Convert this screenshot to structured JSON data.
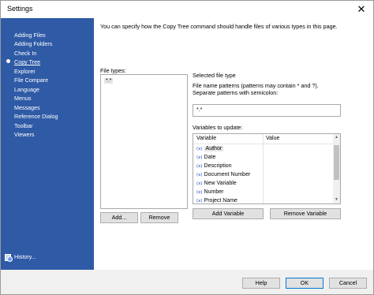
{
  "window": {
    "title": "Settings",
    "close_glyph": "✕"
  },
  "sidebar": {
    "items": [
      {
        "label": "Adding Files"
      },
      {
        "label": "Adding Folders"
      },
      {
        "label": "Check In"
      },
      {
        "label": "Copy Tree",
        "selected": true
      },
      {
        "label": "Explorer"
      },
      {
        "label": "File Compare"
      },
      {
        "label": "Language"
      },
      {
        "label": "Menus"
      },
      {
        "label": "Messages"
      },
      {
        "label": "Reference Dialog"
      },
      {
        "label": "Toolbar"
      },
      {
        "label": "Viewers"
      }
    ],
    "history_label": "History..."
  },
  "content": {
    "description": "You can specify how the Copy Tree command should handle files of various types in this page.",
    "file_types_label": "File types:",
    "file_types": [
      "*.*"
    ],
    "add_button": "Add...",
    "remove_button": "Remove",
    "selected_file_type_label": "Selected file type",
    "patterns_help_line1": "File name patterns (patterns may contain * and ?).",
    "patterns_help_line2": "Separate patterns with semicolon:",
    "patterns_value": "*.*",
    "variables_label": "Variables to update:",
    "variables_columns": {
      "variable": "Variable",
      "value": "Value"
    },
    "variables": [
      "Author",
      "Date",
      "Description",
      "Document Number",
      "New Variable",
      "Number",
      "Project Name"
    ],
    "variable_icon": "(x)",
    "add_variable_button": "Add Variable",
    "remove_variable_button": "Remove Variable"
  },
  "footer": {
    "help": "Help",
    "ok": "OK",
    "cancel": "Cancel"
  }
}
